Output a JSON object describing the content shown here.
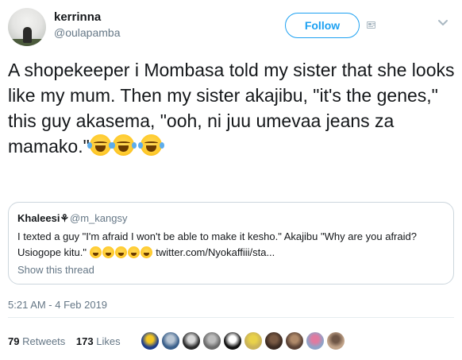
{
  "header": {
    "display_name": "kerrinna",
    "handle": "@oulapamba",
    "follow_label": "Follow",
    "avatar_icon": "profile-photo-landscape",
    "extra_icon": "user-card-icon",
    "menu_icon": "chevron-down-icon"
  },
  "tweet": {
    "text": "A shopekeeper i Mombasa told my sister that she looks like my mum. Then my sister akajibu, \"it's the genes,\" this guy akasema, \"ooh, ni juu umevaa jeans za mamako.\"",
    "emoji": "face-with-tears-of-joy",
    "emoji_count": 3
  },
  "quoted": {
    "display_name": "Khaleesi",
    "verified_glyph": "⚘",
    "handle": "@m_kangsy",
    "text_part1": "I texted a guy \"I'm afraid I won't be able to make it kesho.\" Akajibu  \"Why are you afraid? Usiogope kitu.\"",
    "emoji_count": 5,
    "link": "twitter.com/Nyokaffiii/sta...",
    "show_thread": "Show this thread"
  },
  "timestamp": "5:21 AM - 4 Feb 2019",
  "stats": {
    "retweets_count": "79",
    "retweets_label": "Retweets",
    "likes_count": "173",
    "likes_label": "Likes"
  },
  "likers": [
    {
      "color": "#1d3d8c",
      "accent": "#f3c623"
    },
    {
      "color": "#3a5f8a",
      "accent": "#b9c6d4"
    },
    {
      "color": "#2b2b2b",
      "accent": "#d9d9d9"
    },
    {
      "color": "#6a6a6a",
      "accent": "#bdbdbd"
    },
    {
      "color": "#111111",
      "accent": "#ffffff"
    },
    {
      "color": "#c9b25a",
      "accent": "#e9d24a"
    },
    {
      "color": "#3b2a22",
      "accent": "#7a5a44"
    },
    {
      "color": "#5a4236",
      "accent": "#b08a6a"
    },
    {
      "color": "#8fa3c8",
      "accent": "#e07aa0"
    },
    {
      "color": "#c2a48a",
      "accent": "#6f5646"
    }
  ]
}
